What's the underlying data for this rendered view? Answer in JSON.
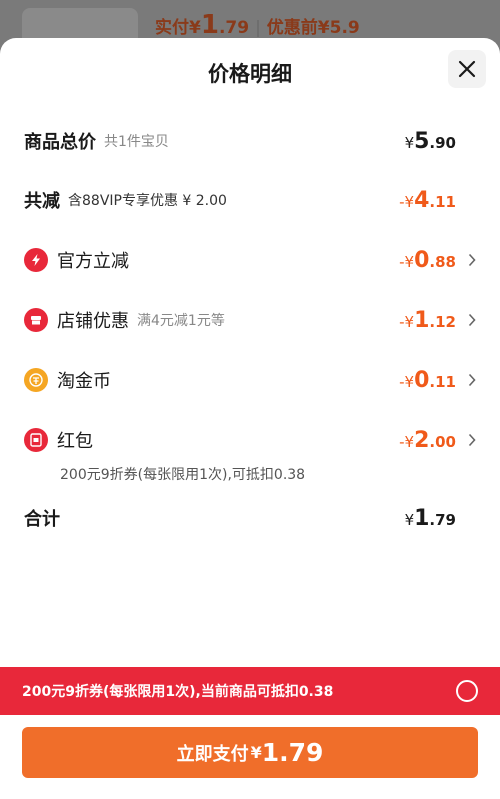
{
  "backdrop": {
    "paid_label": "实付",
    "paid_symbol": "¥",
    "paid_int": "1",
    "paid_dec": ".79",
    "separator": "|",
    "before_label": "优惠前",
    "before_value": "¥5.9"
  },
  "sheet": {
    "title": "价格明细"
  },
  "rows": {
    "total": {
      "label": "商品总价",
      "sub": "共1件宝贝",
      "sym": "¥",
      "int": "5",
      "dec": ".90"
    },
    "reduce": {
      "label": "共减",
      "sub": "含88VIP专享优惠 ¥ 2.00",
      "sym": "-¥",
      "int": "4",
      "dec": ".11"
    },
    "official": {
      "label": "官方立减",
      "icon": "lightning-icon",
      "sym": "-¥",
      "int": "0",
      "dec": ".88"
    },
    "store": {
      "label": "店铺优惠",
      "icon": "store-icon",
      "sub": "满4元减1元等",
      "sym": "-¥",
      "int": "1",
      "dec": ".12"
    },
    "coins": {
      "label": "淘金币",
      "icon": "coin-icon",
      "sym": "-¥",
      "int": "0",
      "dec": ".11"
    },
    "redpacket": {
      "label": "红包",
      "icon": "red-packet-icon",
      "sym": "-¥",
      "int": "2",
      "dec": ".00",
      "note": "200元9折券(每张限用1次),可抵扣0.38"
    },
    "sum": {
      "label": "合计",
      "sym": "¥",
      "int": "1",
      "dec": ".79"
    }
  },
  "coupon_bar": {
    "text": "200元9折券(每张限用1次),当前商品可抵扣0.38"
  },
  "pay_button": {
    "label": "立即支付",
    "sym": "¥",
    "amount": "1.79"
  },
  "colors": {
    "accent_orange": "#f05a1a",
    "coupon_red": "#e8283a",
    "pay_orange": "#f06e2a"
  }
}
